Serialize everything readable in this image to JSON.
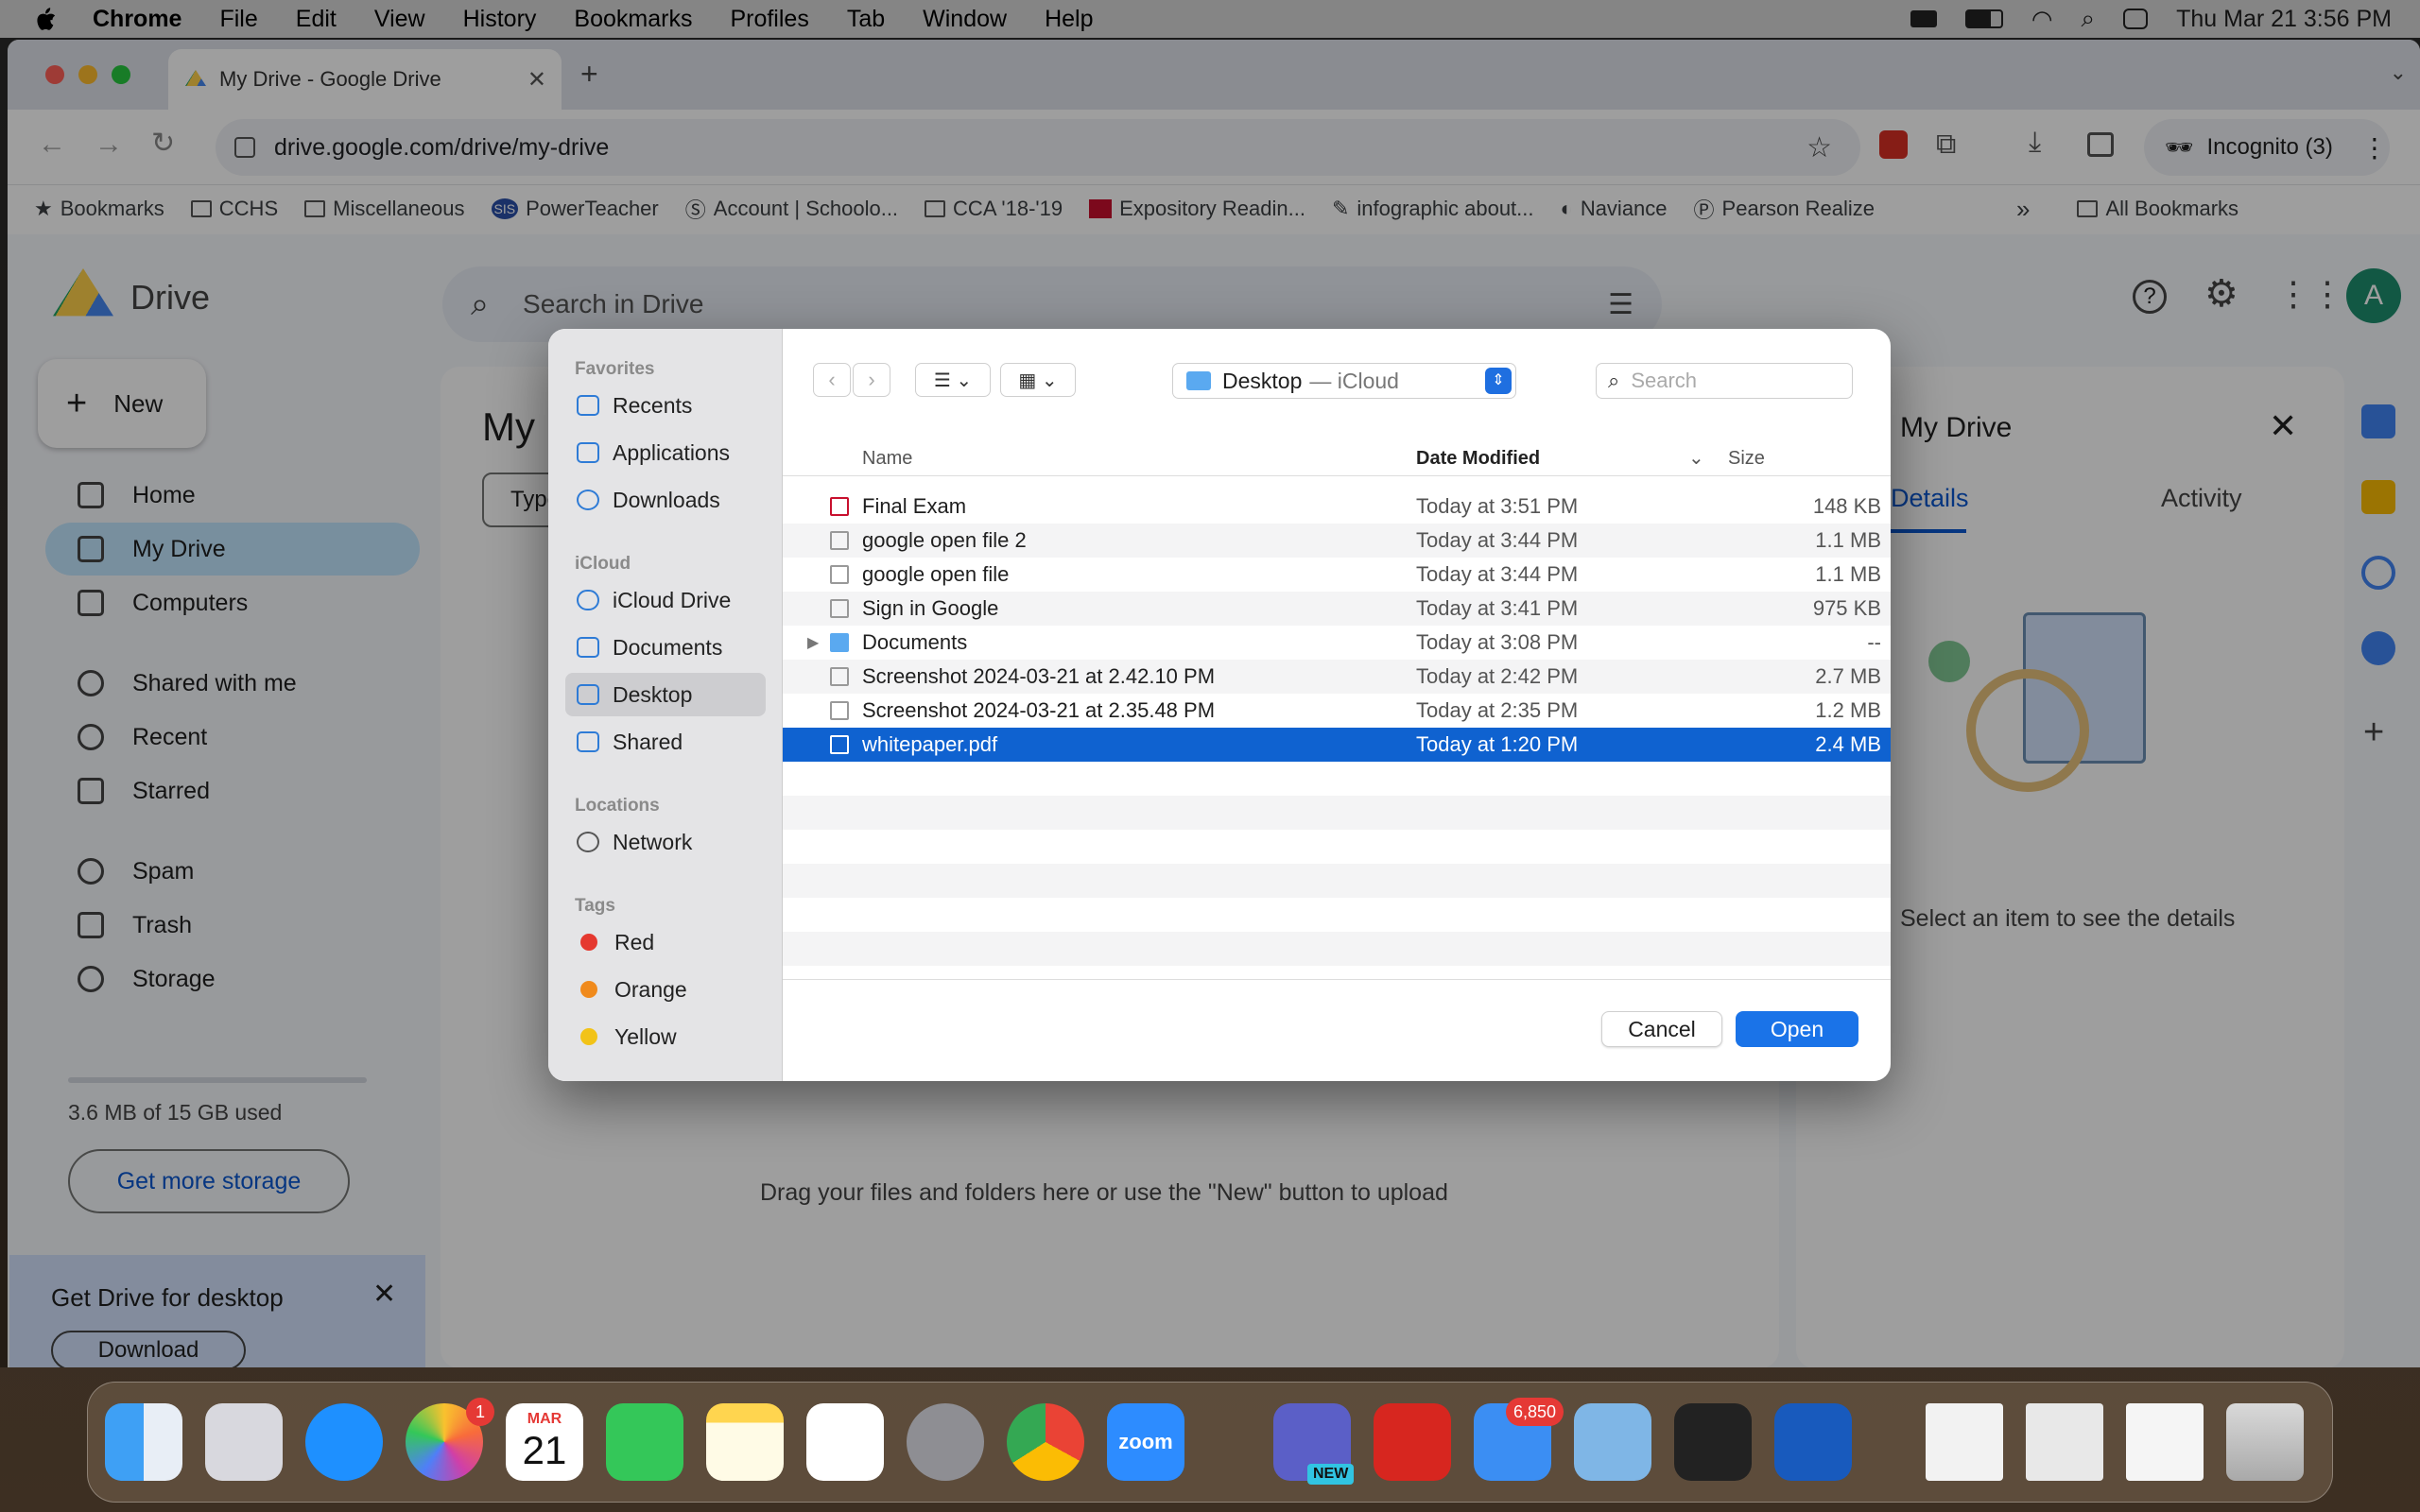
{
  "menubar": {
    "app": "Chrome",
    "items": [
      "File",
      "Edit",
      "View",
      "History",
      "Bookmarks",
      "Profiles",
      "Tab",
      "Window",
      "Help"
    ],
    "clock": "Thu Mar 21  3:56 PM"
  },
  "browser": {
    "tab_title": "My Drive - Google Drive",
    "url": "drive.google.com/drive/my-drive",
    "incognito": "Incognito (3)",
    "bookmarks": [
      "Bookmarks",
      "CCHS",
      "Miscellaneous",
      "PowerTeacher",
      "Account | Schoolo...",
      "CCA '18-'19",
      "Expository Readin...",
      "infographic about...",
      "Naviance",
      "Pearson Realize"
    ],
    "all_bookmarks": "All Bookmarks"
  },
  "drive": {
    "brand": "Drive",
    "search_placeholder": "Search in Drive",
    "new_label": "New",
    "nav": [
      "Home",
      "My Drive",
      "Computers",
      "Shared with me",
      "Recent",
      "Starred",
      "Spam",
      "Trash",
      "Storage"
    ],
    "storage_used": "3.6 MB of 15 GB used",
    "get_storage": "Get more storage",
    "page_title": "My Drive",
    "page_title_partial": "My D",
    "filter_partial": "Type",
    "drop_hint": "Drag your files and folders here or use the \"New\" button to upload",
    "panel_title": "My Drive",
    "panel_tabs": [
      "Details",
      "Activity"
    ],
    "panel_empty": "Select an item to see the details",
    "promo_title": "Get Drive for desktop",
    "promo_button": "Download",
    "avatar": "A"
  },
  "dialog": {
    "sections": {
      "favorites": "Favorites",
      "icloud": "iCloud",
      "locations": "Locations",
      "tags": "Tags"
    },
    "favorites": [
      "Recents",
      "Applications",
      "Downloads"
    ],
    "icloud": [
      "iCloud Drive",
      "Documents",
      "Desktop",
      "Shared"
    ],
    "locations": [
      "Network"
    ],
    "tags": [
      {
        "name": "Red",
        "color": "#e5382f"
      },
      {
        "name": "Orange",
        "color": "#f08a1c"
      },
      {
        "name": "Yellow",
        "color": "#f2c318"
      }
    ],
    "location_title": "Desktop",
    "location_sub": "— iCloud",
    "search_placeholder": "Search",
    "columns": {
      "name": "Name",
      "date": "Date Modified",
      "size": "Size"
    },
    "files": [
      {
        "name": "Final Exam",
        "date": "Today at 3:51 PM",
        "size": "148 KB"
      },
      {
        "name": "google open file 2",
        "date": "Today at 3:44 PM",
        "size": "1.1 MB"
      },
      {
        "name": "google open file",
        "date": "Today at 3:44 PM",
        "size": "1.1 MB"
      },
      {
        "name": "Sign in Google",
        "date": "Today at 3:41 PM",
        "size": "975 KB"
      },
      {
        "name": "Documents",
        "date": "Today at 3:08 PM",
        "size": "--"
      },
      {
        "name": "Screenshot 2024-03-21 at 2.42.10 PM",
        "date": "Today at 2:42 PM",
        "size": "2.7 MB"
      },
      {
        "name": "Screenshot 2024-03-21 at 2.35.48 PM",
        "date": "Today at 2:35 PM",
        "size": "1.2 MB"
      },
      {
        "name": "whitepaper.pdf",
        "date": "Today at 1:20 PM",
        "size": "2.4 MB"
      }
    ],
    "cancel": "Cancel",
    "open": "Open"
  },
  "dock": {
    "calendar_month": "MAR",
    "calendar_day": "21",
    "photos_badge": "1",
    "mail_badge": "6,850",
    "zoom_label": "zoom",
    "teams_badge": "NEW"
  }
}
